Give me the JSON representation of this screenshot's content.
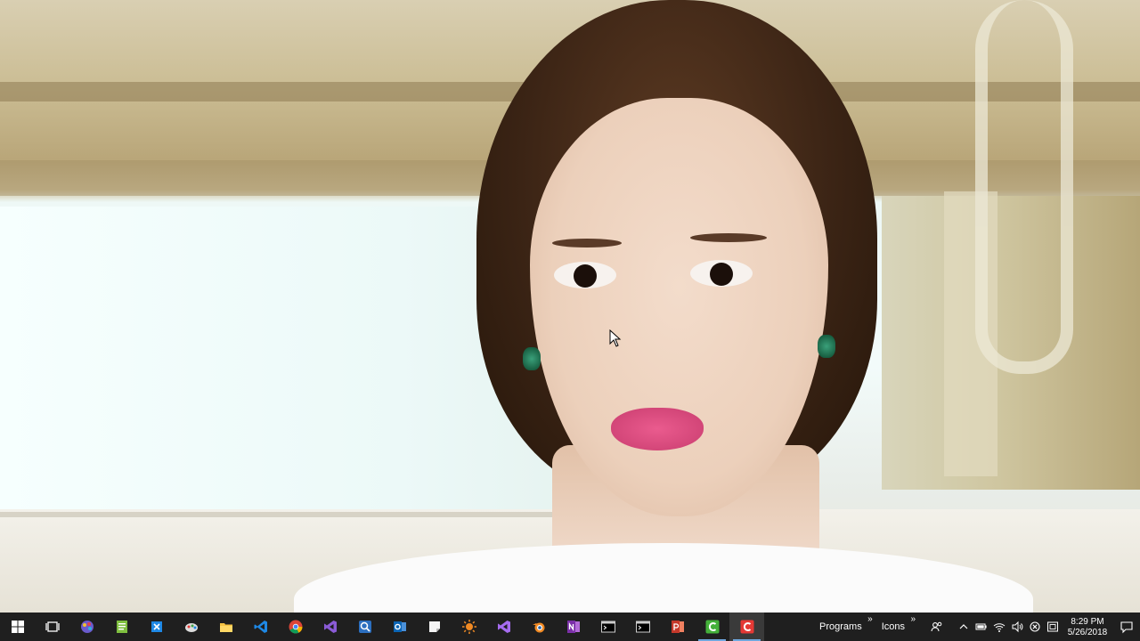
{
  "taskbar": {
    "pinned": [
      {
        "name": "start-button",
        "icon": "windows-logo-icon"
      },
      {
        "name": "task-view-button",
        "icon": "task-view-icon"
      },
      {
        "name": "app-paint-studio",
        "icon": "paint-palette-icon"
      },
      {
        "name": "app-notepad",
        "icon": "notepad-icon"
      },
      {
        "name": "app-snipping",
        "icon": "snip-icon"
      },
      {
        "name": "app-paint",
        "icon": "paint-icon"
      },
      {
        "name": "app-file-explorer",
        "icon": "folder-icon"
      },
      {
        "name": "app-vscode",
        "icon": "vscode-icon"
      },
      {
        "name": "app-chrome",
        "icon": "chrome-icon"
      },
      {
        "name": "app-visual-studio",
        "icon": "visual-studio-icon"
      },
      {
        "name": "app-search-tool",
        "icon": "magnifier-app-icon"
      },
      {
        "name": "app-outlook",
        "icon": "outlook-icon"
      },
      {
        "name": "app-sticky-notes",
        "icon": "sticky-note-icon"
      },
      {
        "name": "app-sun-tool",
        "icon": "sun-icon"
      },
      {
        "name": "app-visual-studio-2",
        "icon": "visual-studio-purple-icon"
      },
      {
        "name": "app-blender",
        "icon": "blender-icon"
      },
      {
        "name": "app-onenote",
        "icon": "onenote-icon"
      },
      {
        "name": "app-terminal-1",
        "icon": "terminal-icon"
      },
      {
        "name": "app-terminal-2",
        "icon": "terminal-icon"
      },
      {
        "name": "app-powerpoint",
        "icon": "powerpoint-icon"
      },
      {
        "name": "app-green-c",
        "icon": "green-c-icon"
      },
      {
        "name": "app-red-c",
        "icon": "red-c-icon"
      }
    ],
    "toolbars": {
      "programs_label": "Programs",
      "icons_label": "Icons",
      "chevron": "»"
    },
    "clock": {
      "time": "8:29 PM",
      "date": "5/26/2018"
    },
    "colors": {
      "taskbar_bg": "#1f1f1f",
      "active_underline": "#6ea7de"
    }
  }
}
